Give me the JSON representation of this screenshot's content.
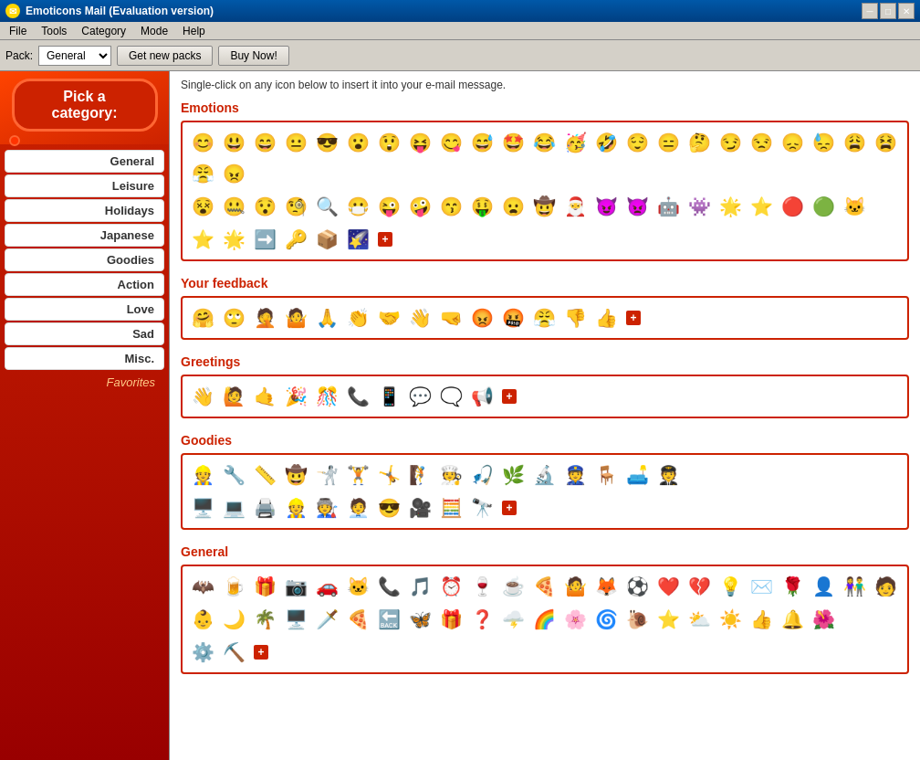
{
  "titleBar": {
    "title": "Emoticons Mail  (Evaluation version)",
    "minBtn": "─",
    "maxBtn": "□",
    "closeBtn": "✕"
  },
  "menuBar": {
    "items": [
      "File",
      "Tools",
      "Category",
      "Mode",
      "Help"
    ]
  },
  "toolbar": {
    "packLabel": "Pack:",
    "packValue": "General",
    "getNewPacks": "Get new packs",
    "buyNow": "Buy Now!"
  },
  "sidebar": {
    "pickCategory": "Pick a category:",
    "categories": [
      {
        "label": "General",
        "active": true
      },
      {
        "label": "Leisure"
      },
      {
        "label": "Holidays"
      },
      {
        "label": "Japanese"
      },
      {
        "label": "Goodies"
      },
      {
        "label": "Action"
      },
      {
        "label": "Love"
      },
      {
        "label": "Sad"
      },
      {
        "label": "Misc."
      },
      {
        "label": "Favorites",
        "style": "favorites"
      }
    ]
  },
  "content": {
    "instruction": "Single-click on any icon below to insert it into your e-mail message.",
    "sections": [
      {
        "title": "Emotions"
      },
      {
        "title": "Your feedback"
      },
      {
        "title": "Greetings"
      },
      {
        "title": "Goodies"
      },
      {
        "title": "General"
      }
    ]
  }
}
